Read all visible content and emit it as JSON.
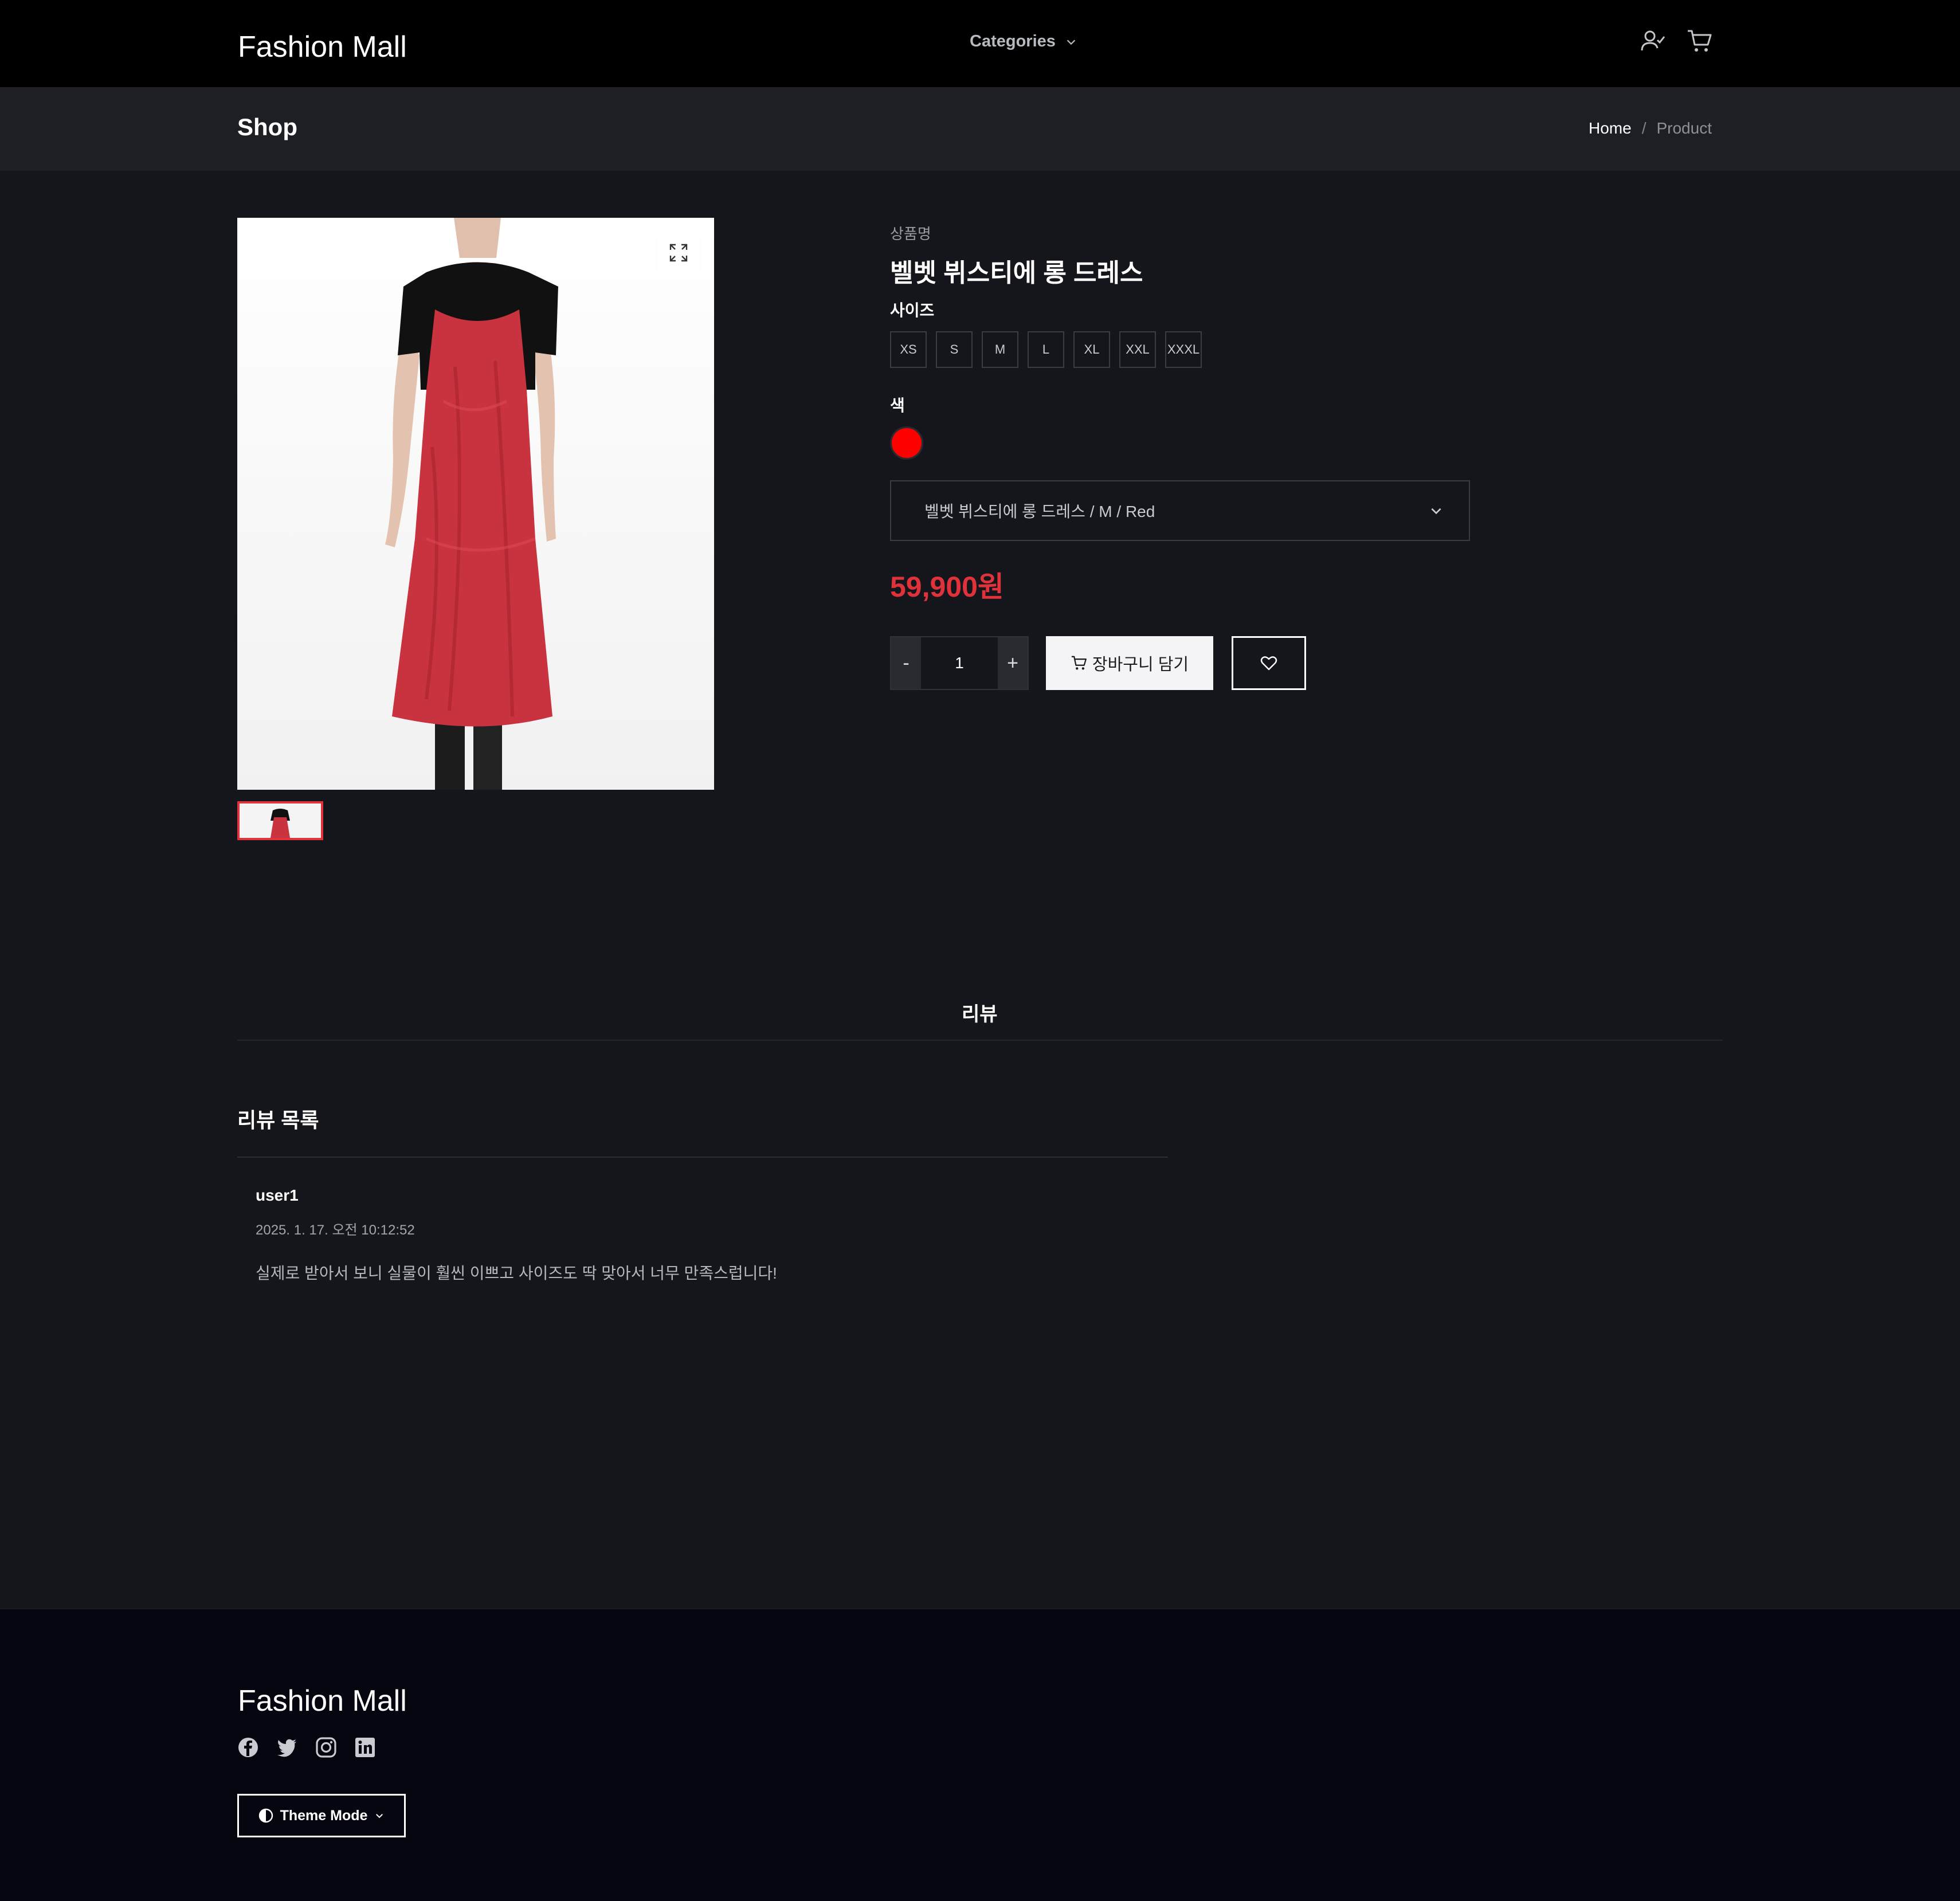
{
  "header": {
    "brand": "Fashion Mall",
    "categories_label": "Categories"
  },
  "title_bar": {
    "page_title": "Shop",
    "breadcrumb": [
      "Home",
      "/",
      "Product"
    ]
  },
  "product": {
    "name_label": "상품명",
    "title": "벨벳 뷔스티에 롱 드레스",
    "size_label": "사이즈",
    "sizes": [
      "XS",
      "S",
      "M",
      "L",
      "XL",
      "XXL",
      "XXXL"
    ],
    "color_label": "색",
    "color_swatch": "#ff0000",
    "selected_variant": "벨벳 뷔스티에 롱 드레스 / M / Red",
    "price": "59,900원",
    "quantity": "1",
    "qty_minus": "-",
    "qty_plus": "+",
    "add_to_cart": "장바구니 담기"
  },
  "reviews": {
    "tab_label": "리뷰",
    "list_title": "리뷰 목록",
    "items": [
      {
        "user": "user1",
        "date": "2025. 1. 17. 오전 10:12:52",
        "text": "실제로 받아서 보니 실물이 훨씬 이쁘고 사이즈도 딱 맞아서 너무 만족스럽니다!"
      }
    ]
  },
  "footer": {
    "brand": "Fashion Mall",
    "social": [
      "facebook-icon",
      "twitter-icon",
      "instagram-icon",
      "linkedin-icon"
    ],
    "theme_mode": "Theme Mode"
  },
  "colors": {
    "accent_red": "#e0323b",
    "background": "#15161b",
    "header": "#000000",
    "title_bar": "#1e1f24"
  }
}
